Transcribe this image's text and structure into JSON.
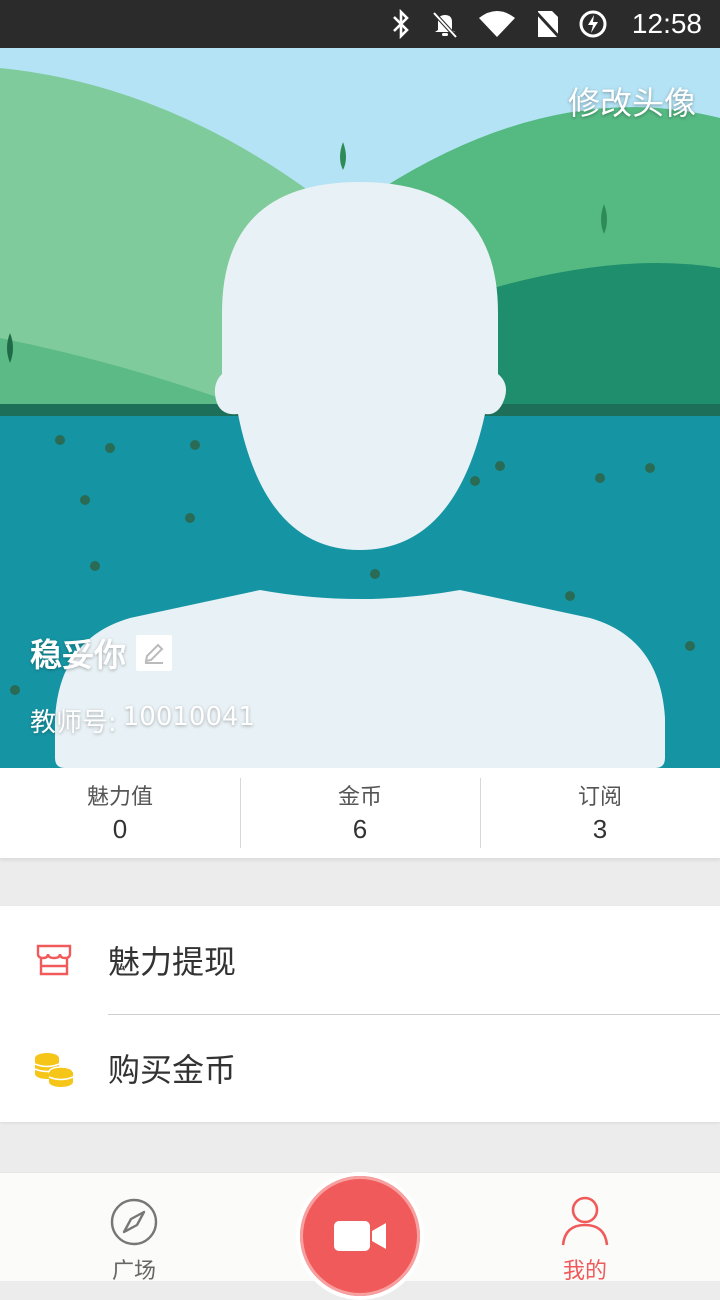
{
  "status_bar": {
    "time": "12:58"
  },
  "profile": {
    "change_avatar_label": "修改头像",
    "nickname": "稳妥你",
    "teacher_id_label": "教师号:",
    "teacher_id_value": "10010041"
  },
  "stats": [
    {
      "label": "魅力值",
      "value": "0"
    },
    {
      "label": "金币",
      "value": "6"
    },
    {
      "label": "订阅",
      "value": "3"
    }
  ],
  "menu": {
    "items": [
      {
        "label": "魅力提现",
        "icon": "store-icon"
      },
      {
        "label": "购买金币",
        "icon": "coins-icon"
      }
    ]
  },
  "tabbar": {
    "tabs": [
      {
        "label": "广场",
        "icon": "compass-icon"
      },
      {
        "label": "我的",
        "icon": "user-icon"
      }
    ],
    "center_icon": "video-camera-icon"
  },
  "colors": {
    "accent": "#f15a5a",
    "tab_inactive": "#666666",
    "coin": "#f5c518"
  }
}
